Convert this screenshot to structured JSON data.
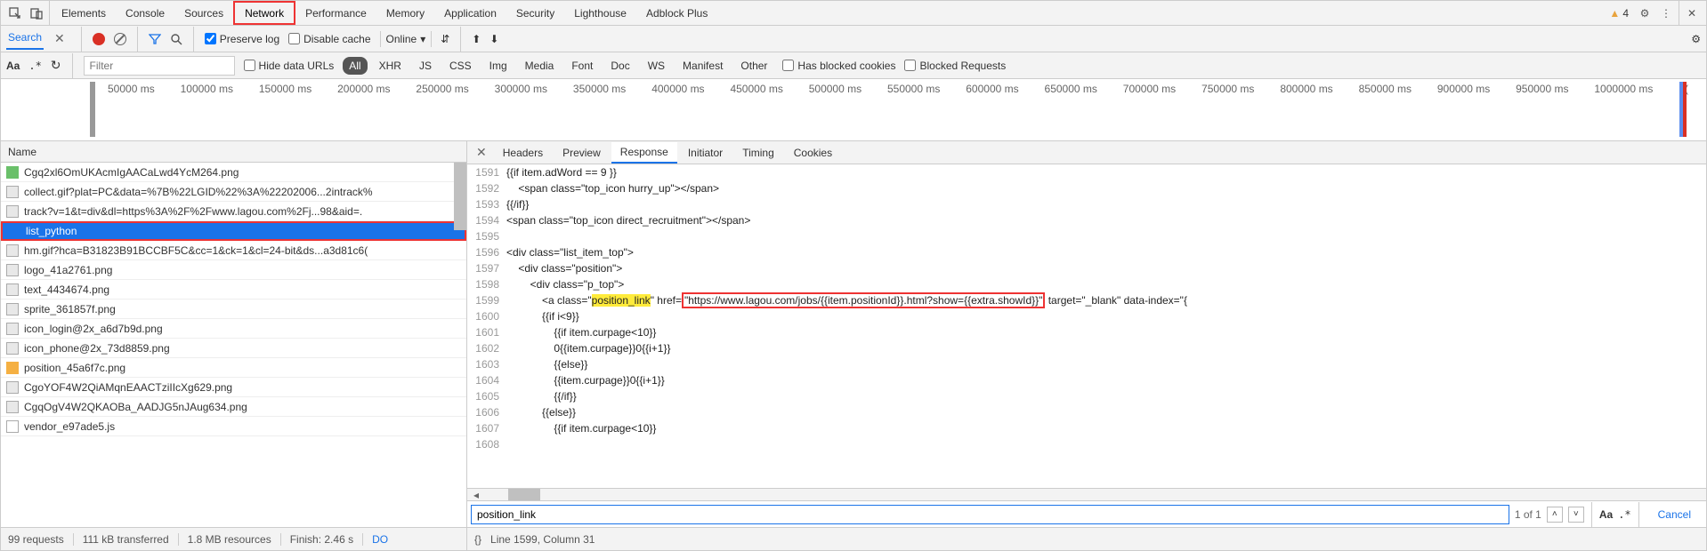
{
  "top_tabs": {
    "items": [
      "Elements",
      "Console",
      "Sources",
      "Network",
      "Performance",
      "Memory",
      "Application",
      "Security",
      "Lighthouse",
      "Adblock Plus"
    ],
    "active": "Network",
    "warning_count": "4"
  },
  "toolbar": {
    "search_label": "Search",
    "preserve_log": "Preserve log",
    "disable_cache": "Disable cache",
    "throttle": "Online",
    "aa": "Aa",
    "regex": ".*"
  },
  "filter": {
    "placeholder": "Filter",
    "hide_data_urls": "Hide data URLs",
    "types": [
      "All",
      "XHR",
      "JS",
      "CSS",
      "Img",
      "Media",
      "Font",
      "Doc",
      "WS",
      "Manifest",
      "Other"
    ],
    "active_type": "All",
    "has_blocked": "Has blocked cookies",
    "blocked_req": "Blocked Requests"
  },
  "timeline": {
    "ticks": [
      "50000 ms",
      "100000 ms",
      "150000 ms",
      "200000 ms",
      "250000 ms",
      "300000 ms",
      "350000 ms",
      "400000 ms",
      "450000 ms",
      "500000 ms",
      "550000 ms",
      "600000 ms",
      "650000 ms",
      "700000 ms",
      "750000 ms",
      "800000 ms",
      "850000 ms",
      "900000 ms",
      "950000 ms",
      "1000000 ms",
      "1("
    ]
  },
  "requests": {
    "header": "Name",
    "rows": [
      {
        "icon": "green",
        "name": "Cgq2xl6OmUKAcmIgAACaLwd4YcM264.png"
      },
      {
        "icon": "img",
        "name": "collect.gif?plat=PC&data=%7B%22LGID%22%3A%22202006...2intrack%"
      },
      {
        "icon": "img",
        "name": "track?v=1&t=div&dl=https%3A%2F%2Fwww.lagou.com%2Fj...98&aid=."
      },
      {
        "icon": "blue",
        "name": "list_python",
        "selected": true
      },
      {
        "icon": "img",
        "name": "hm.gif?hca=B31823B91BCCBF5C&cc=1&ck=1&cl=24-bit&ds...a3d81c6("
      },
      {
        "icon": "img",
        "name": "logo_41a2761.png"
      },
      {
        "icon": "img",
        "name": "text_4434674.png"
      },
      {
        "icon": "img",
        "name": "sprite_361857f.png"
      },
      {
        "icon": "img",
        "name": "icon_login@2x_a6d7b9d.png"
      },
      {
        "icon": "img",
        "name": "icon_phone@2x_73d8859.png"
      },
      {
        "icon": "orange",
        "name": "position_45a6f7c.png"
      },
      {
        "icon": "img",
        "name": "CgoYOF4W2QiAMqnEAACTziIIcXg629.png"
      },
      {
        "icon": "img",
        "name": "CgqOgV4W2QKAOBa_AADJG5nJAug634.png"
      },
      {
        "icon": "script",
        "name": "vendor_e97ade5.js"
      }
    ]
  },
  "left_status": {
    "requests": "99 requests",
    "transferred": "111 kB transferred",
    "resources": "1.8 MB resources",
    "finish": "Finish: 2.46 s",
    "dom": "DO"
  },
  "detail_tabs": {
    "items": [
      "Headers",
      "Preview",
      "Response",
      "Initiator",
      "Timing",
      "Cookies"
    ],
    "active": "Response"
  },
  "code": {
    "lines": [
      {
        "n": "1591",
        "t": "{{if item.adWord == 9 }}"
      },
      {
        "n": "1592",
        "t": "    <span class=\"top_icon hurry_up\"></span>"
      },
      {
        "n": "1593",
        "t": "{{/if}}"
      },
      {
        "n": "1594",
        "t": "<span class=\"top_icon direct_recruitment\"></span>"
      },
      {
        "n": "1595",
        "t": ""
      },
      {
        "n": "1596",
        "t": "<div class=\"list_item_top\">"
      },
      {
        "n": "1597",
        "t": "    <div class=\"position\">"
      },
      {
        "n": "1598",
        "t": "        <div class=\"p_top\">"
      },
      {
        "n": "1599",
        "t_prefix": "            <a class=\"",
        "t_hl": "position_link",
        "t_mid": "\" href=",
        "t_box": "\"https://www.lagou.com/jobs/{{item.positionId}}.html?show={{extra.showId}}\"",
        "t_suffix": " target=\"_blank\" data-index=\"{"
      },
      {
        "n": "1600",
        "t": "            {{if i<9}}"
      },
      {
        "n": "1601",
        "t": "                {{if item.curpage<10}}"
      },
      {
        "n": "1602",
        "t": "                0{{item.curpage}}0{{i+1}}"
      },
      {
        "n": "1603",
        "t": "                {{else}}"
      },
      {
        "n": "1604",
        "t": "                {{item.curpage}}0{{i+1}}"
      },
      {
        "n": "1605",
        "t": "                {{/if}}"
      },
      {
        "n": "1606",
        "t": "            {{else}}"
      },
      {
        "n": "1607",
        "t": "                {{if item.curpage<10}}"
      },
      {
        "n": "1608",
        "t": ""
      }
    ]
  },
  "search_in": {
    "value": "position_link",
    "count": "1 of 1",
    "aa": "Aa",
    "regex": ".*",
    "cancel": "Cancel"
  },
  "right_status": {
    "braces": "{}",
    "cursor": "Line 1599, Column 31"
  }
}
